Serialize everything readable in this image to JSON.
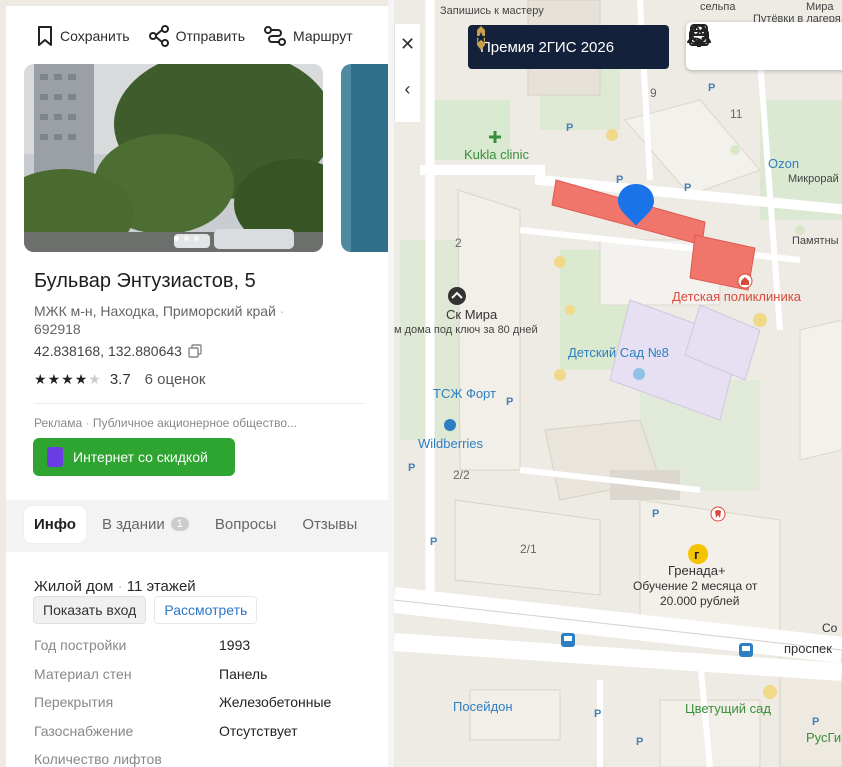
{
  "map": {
    "premium_label": "Премия 2ГИС 2026",
    "labels": {
      "kukla": "Kukla clinic",
      "ozon": "Ozon",
      "mikrorai": "Микрорай",
      "pamyatny": "Памятны",
      "detskaya": "Детская поликлиника",
      "sk_mira": "Ск Мира",
      "sk_mira_sub": "м дома под ключ за 80 дней",
      "detsad": "Детский Сад №8",
      "tszh": "ТСЖ Форт",
      "wildberries": "Wildberries",
      "grenada": "Гренада+",
      "grenada_sub1": "Обучение 2 месяца от",
      "grenada_sub2": "20.000 рублей",
      "poseidon": "Посейдон",
      "tsvetushchiy": "Цветущий сад",
      "prospekt": "проспек",
      "so": "Со",
      "rusgi": "РусГи",
      "top1": "Запишись к мастеру",
      "top2": "сельпа",
      "top3": "Путёвки в лагеря, б",
      "top4": "Мира"
    },
    "house_numbers": [
      "9",
      "11",
      "2",
      "2/2",
      "2/1"
    ]
  },
  "card": {
    "actions": {
      "save": "Сохранить",
      "share": "Отправить",
      "route": "Маршрут"
    },
    "title": "Бульвар Энтузиастов, 5",
    "address_line1": "МЖК м-н, Находка, Приморский край",
    "address_line2": "692918",
    "coords": "42.838168, 132.880643",
    "rating_value": "3.7",
    "rating_count": "6 оценок",
    "rating_stars": 3.5,
    "ad_label": "Реклама",
    "ad_company": "Публичное акционерное общество...",
    "ad_button": "Интернет со скидкой",
    "tabs": [
      {
        "label": "Инфо",
        "count": ""
      },
      {
        "label": "В здании",
        "count": "1"
      },
      {
        "label": "Вопросы",
        "count": ""
      },
      {
        "label": "Отзывы",
        "count": ""
      }
    ],
    "house_type": "Жилой дом",
    "floors": "11 этажей",
    "btn_show_entrance": "Показать вход",
    "btn_look": "Рассмотреть",
    "properties": [
      {
        "key": "Год постройки",
        "value": "1993"
      },
      {
        "key": "Материал стен",
        "value": "Панель"
      },
      {
        "key": "Перекрытия",
        "value": "Железобетонные"
      },
      {
        "key": "Газоснабжение",
        "value": "Отсутствует"
      },
      {
        "key": "Количество лифтов",
        "value": ""
      }
    ]
  },
  "colors": {
    "accent_green": "#2ea530",
    "link_blue": "#2d77c9",
    "selected_building": "#f0756b",
    "pin": "#1a73e8",
    "premium_bg": "#14213a"
  }
}
